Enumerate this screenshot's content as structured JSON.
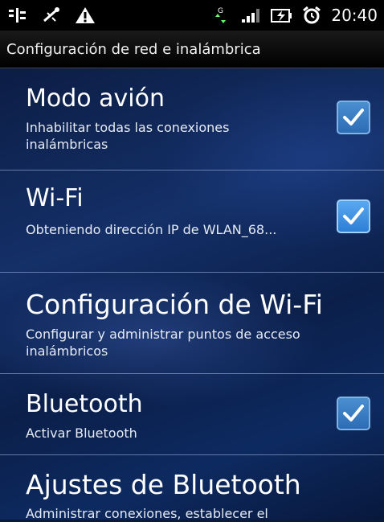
{
  "status_bar": {
    "icons": [
      "usb-debug-icon",
      "usb-connection-icon",
      "warning-icon",
      "gsm-data-icon",
      "signal-strength-icon",
      "battery-charging-icon",
      "alarm-clock-icon"
    ],
    "time": "20:40"
  },
  "screen": {
    "title": "Configuración de red e inalámbrica"
  },
  "items": [
    {
      "title": "Modo avión",
      "summary": "Inhabilitar todas las conexiones inalámbricas",
      "checked": true
    },
    {
      "title": "Wi-Fi",
      "summary": "Obteniendo dirección IP de WLAN_68...",
      "checked": true
    },
    {
      "title": "Configuración de Wi-Fi",
      "summary": "Configurar y administrar puntos de acceso inalámbricos"
    },
    {
      "title": "Bluetooth",
      "summary": "Activar Bluetooth",
      "checked": true
    },
    {
      "title": "Ajustes de Bluetooth",
      "summary": "Administrar conexiones, establecer el"
    }
  ],
  "colors": {
    "checkbox_fill": "#3a8fe0",
    "background": "#0c1d44",
    "status_bar": "#000000"
  }
}
